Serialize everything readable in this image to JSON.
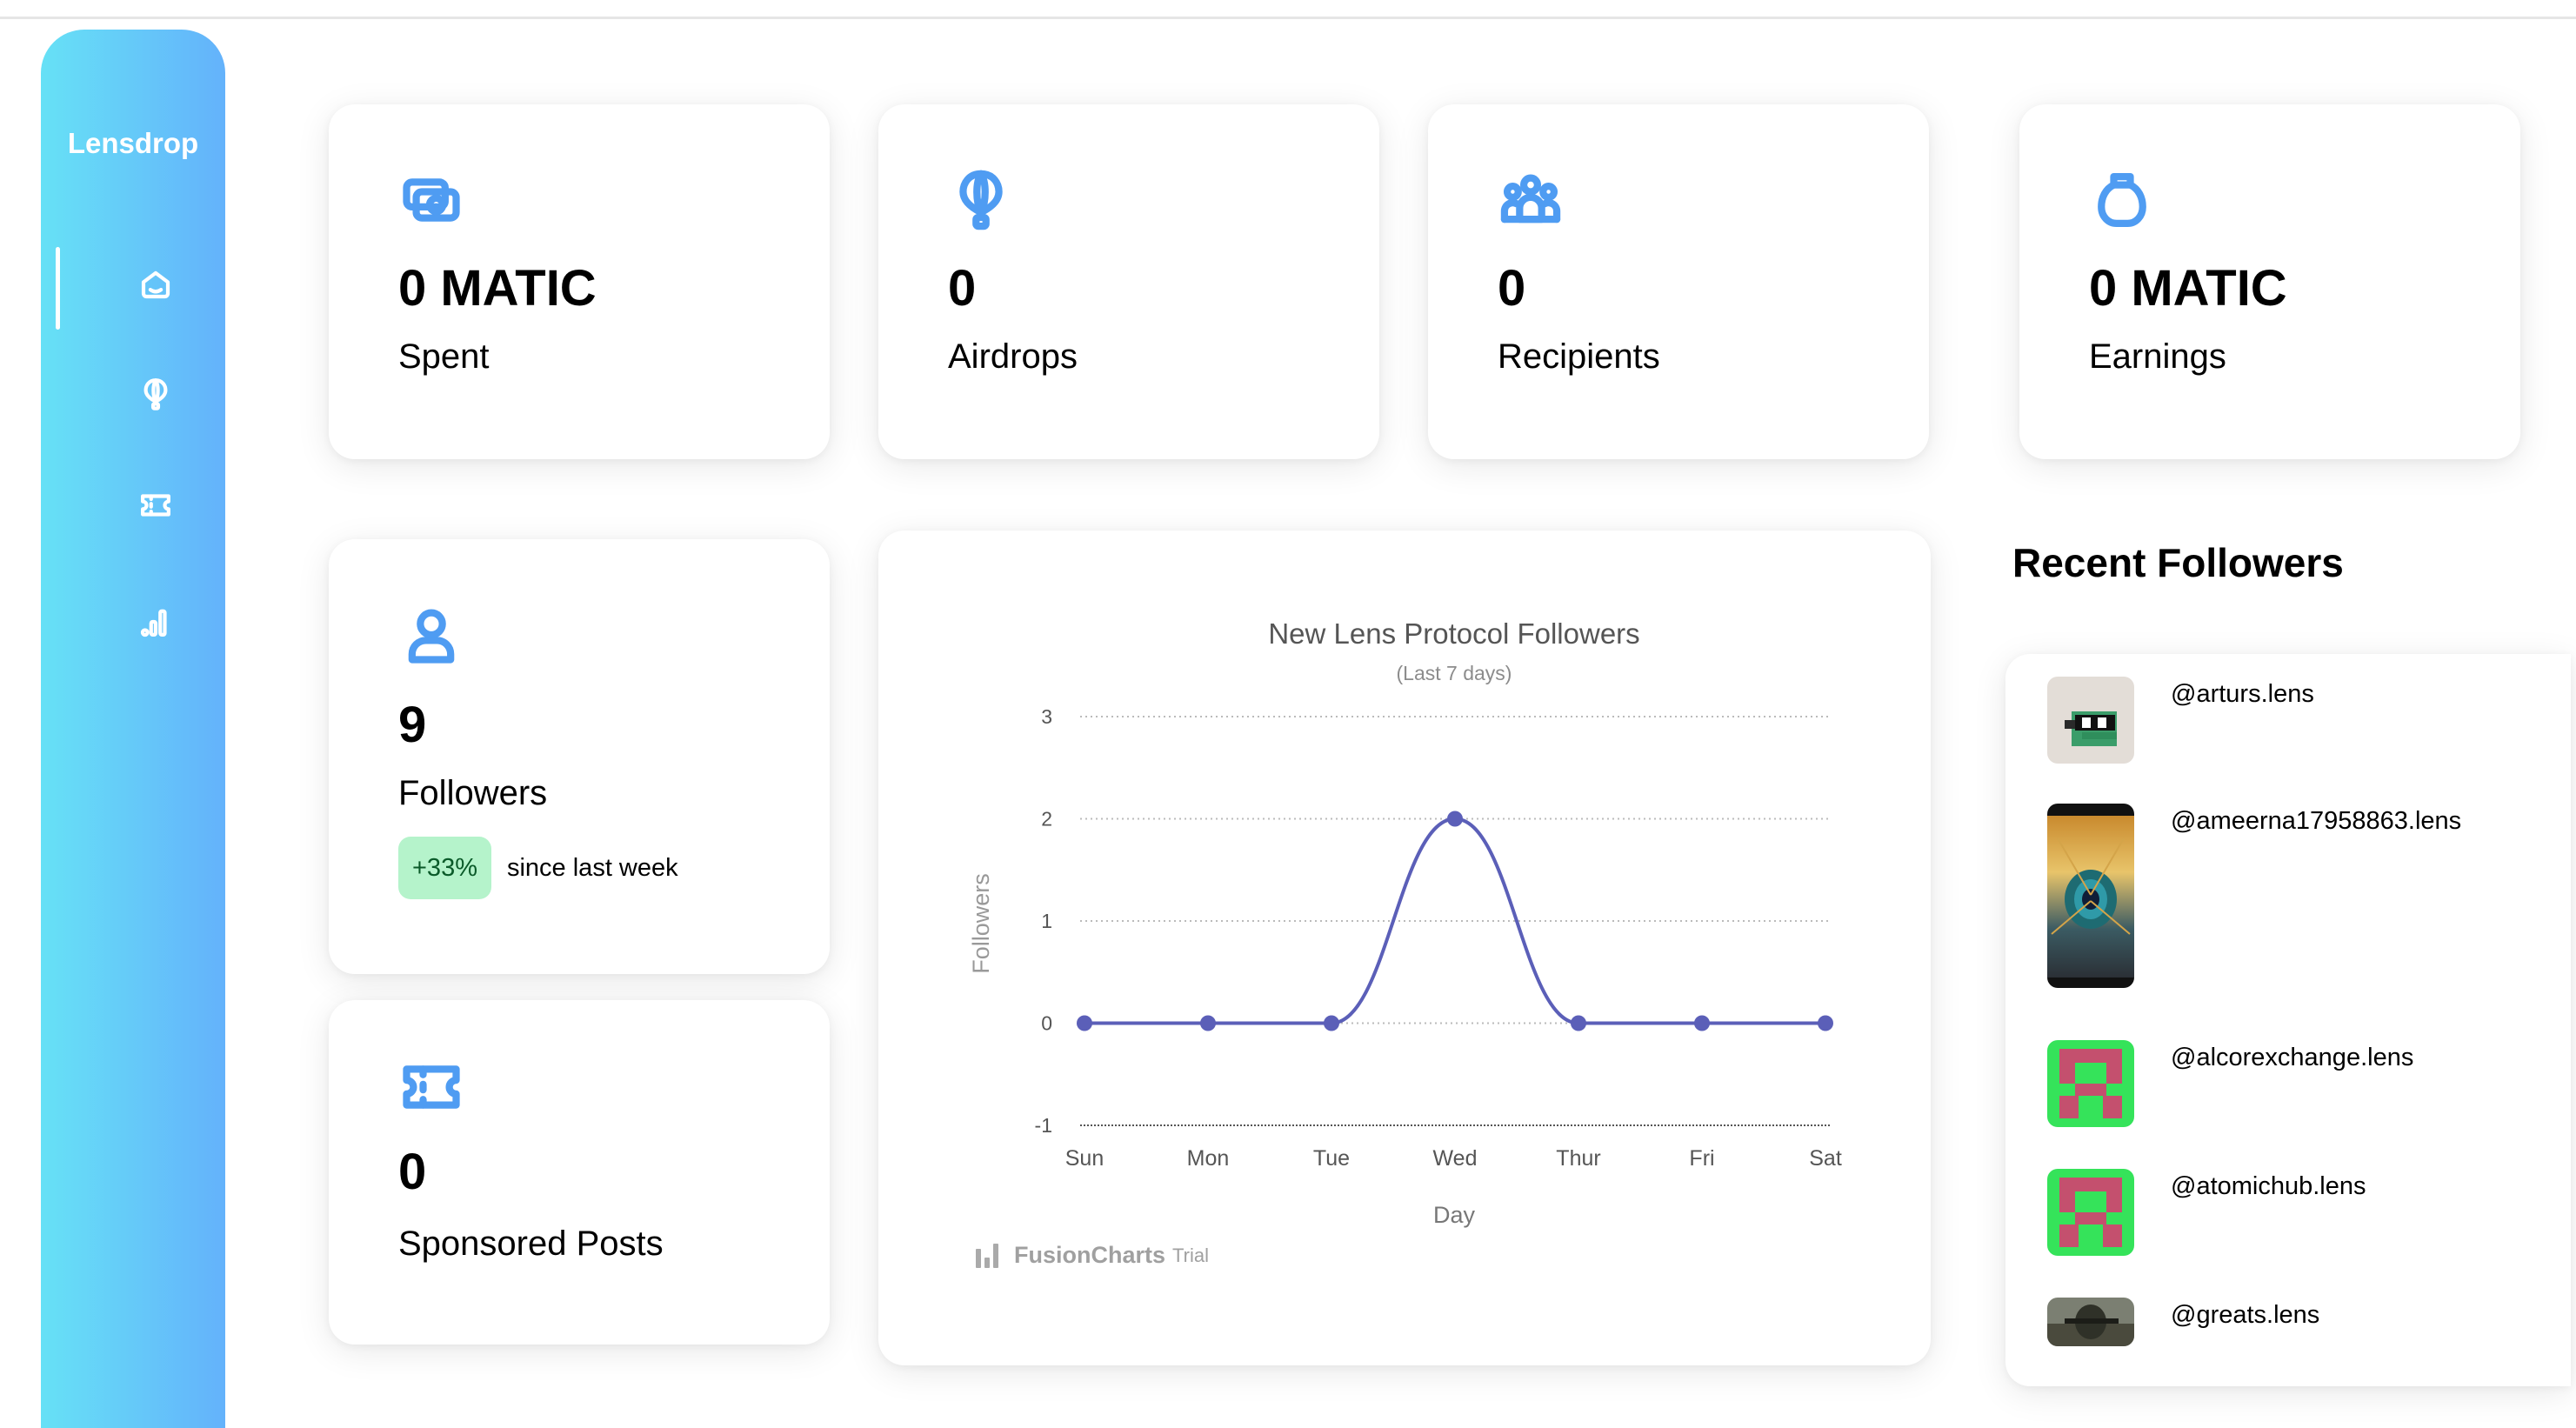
{
  "app": {
    "brand": "Lensdrop"
  },
  "sidebar": {
    "items": [
      {
        "id": "home",
        "icon": "home-icon"
      },
      {
        "id": "airdrops",
        "icon": "balloon-icon"
      },
      {
        "id": "sponsored",
        "icon": "ticket-icon"
      },
      {
        "id": "analytics",
        "icon": "bar-chart-icon"
      }
    ]
  },
  "stats": {
    "spent": {
      "value": "0 MATIC",
      "label": "Spent",
      "icon": "money-icon"
    },
    "airdrops": {
      "value": "0",
      "label": "Airdrops",
      "icon": "balloon-icon"
    },
    "recipients": {
      "value": "0",
      "label": "Recipients",
      "icon": "users-group-icon"
    },
    "earnings": {
      "value": "0 MATIC",
      "label": "Earnings",
      "icon": "money-bag-icon"
    },
    "followers": {
      "value": "9",
      "label": "Followers",
      "icon": "user-icon",
      "delta": "+33%",
      "delta_text": "since last week"
    },
    "sponsored": {
      "value": "0",
      "label": "Sponsored Posts",
      "icon": "ticket-icon"
    }
  },
  "colors": {
    "accent": "#4f9cf2",
    "line": "#5b5fb8",
    "badge_bg": "#b5f3cb",
    "badge_fg": "#0a5a29"
  },
  "chart_data": {
    "type": "line",
    "title": "New Lens Protocol Followers",
    "subtitle": "(Last 7 days)",
    "xlabel": "Day",
    "ylabel": "Followers",
    "categories": [
      "Sun",
      "Mon",
      "Tue",
      "Wed",
      "Thur",
      "Fri",
      "Sat"
    ],
    "values": [
      0,
      0,
      0,
      2,
      0,
      0,
      0
    ],
    "ylim": [
      -1,
      3
    ],
    "yticks": [
      "3",
      "2",
      "1",
      "0",
      "-1"
    ],
    "grid": true,
    "legend": "none"
  },
  "chart_watermark": {
    "name": "FusionCharts",
    "trial": "Trial"
  },
  "recent_followers": {
    "title": "Recent Followers",
    "items": [
      {
        "handle": "@arturs.lens"
      },
      {
        "handle": "@ameerna17958863.lens"
      },
      {
        "handle": "@alcorexchange.lens"
      },
      {
        "handle": "@atomichub.lens"
      },
      {
        "handle": "@greats.lens"
      }
    ]
  }
}
